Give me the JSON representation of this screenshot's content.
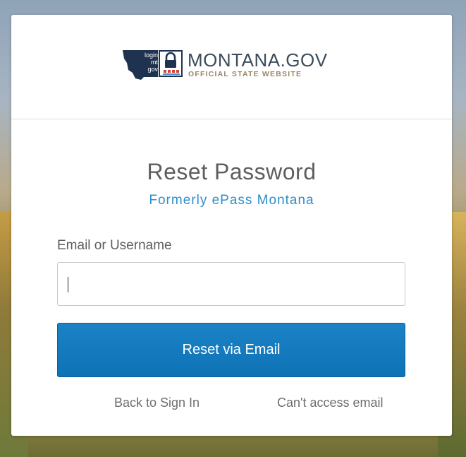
{
  "logo": {
    "login_lines": [
      "login",
      "mt",
      "gov"
    ],
    "title": "MONTANA.GOV",
    "subtitle": "OFFICIAL STATE WEBSITE"
  },
  "page": {
    "title": "Reset Password",
    "subtitle": "Formerly ePass Montana"
  },
  "form": {
    "email_label": "Email or Username",
    "email_value": "",
    "submit_label": "Reset via Email"
  },
  "links": {
    "back": "Back to Sign In",
    "cant_access": "Can't access email"
  },
  "colors": {
    "brand_blue": "#0e73b6",
    "subtitle_blue": "#2d8fcb",
    "logo_navy": "#1f3350"
  },
  "icons": [
    "montana-map-icon",
    "lock-icon"
  ]
}
